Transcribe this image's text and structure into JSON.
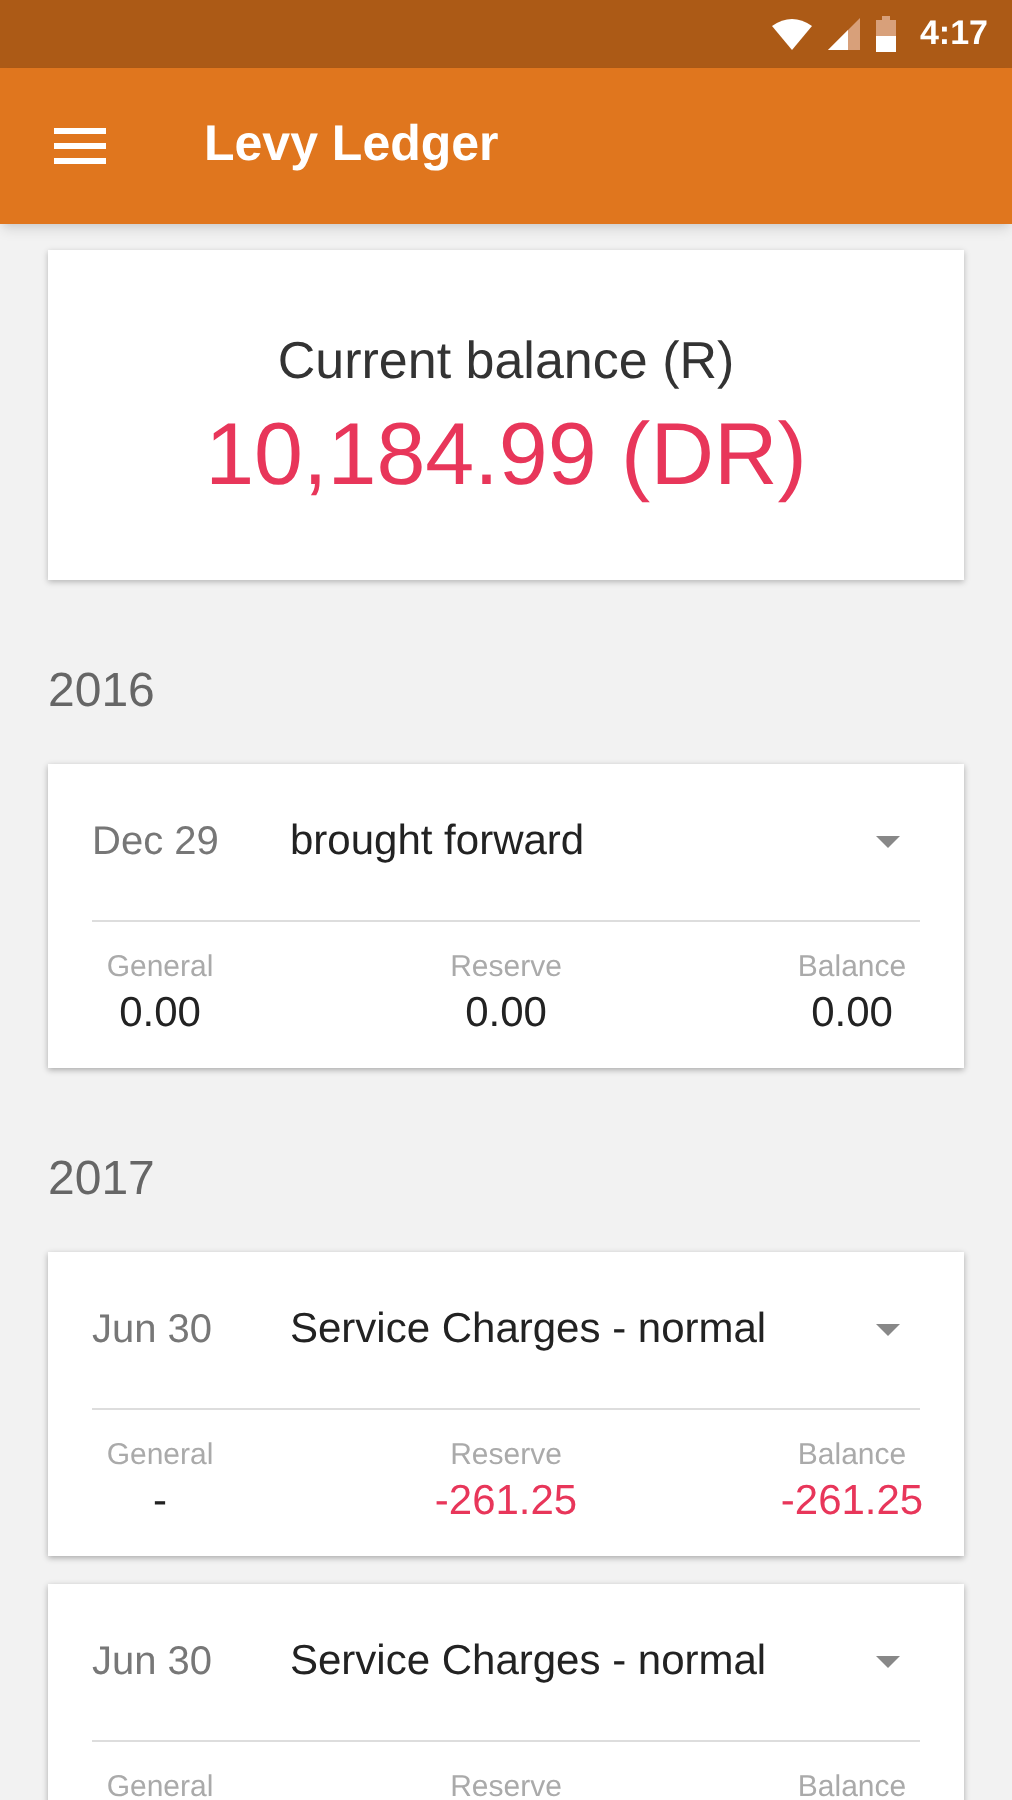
{
  "status_bar": {
    "time": "4:17"
  },
  "app_bar": {
    "title": "Levy Ledger"
  },
  "balance": {
    "label": "Current balance (R)",
    "amount": "10,184.99 (DR)",
    "negative": true
  },
  "years": [
    {
      "year": "2016",
      "entries": [
        {
          "date": "Dec 29",
          "description": "brought forward",
          "columns": [
            {
              "label": "General",
              "value": "0.00",
              "negative": false
            },
            {
              "label": "Reserve",
              "value": "0.00",
              "negative": false
            },
            {
              "label": "Balance",
              "value": "0.00",
              "negative": false
            }
          ]
        }
      ]
    },
    {
      "year": "2017",
      "entries": [
        {
          "date": "Jun 30",
          "description": "Service Charges - normal",
          "columns": [
            {
              "label": "General",
              "value": "-",
              "negative": false
            },
            {
              "label": "Reserve",
              "value": "-261.25",
              "negative": true
            },
            {
              "label": "Balance",
              "value": "-261.25",
              "negative": true
            }
          ]
        },
        {
          "date": "Jun 30",
          "description": "Service Charges - normal",
          "columns": [
            {
              "label": "General"
            },
            {
              "label": "Reserve"
            },
            {
              "label": "Balance"
            }
          ]
        }
      ]
    }
  ]
}
